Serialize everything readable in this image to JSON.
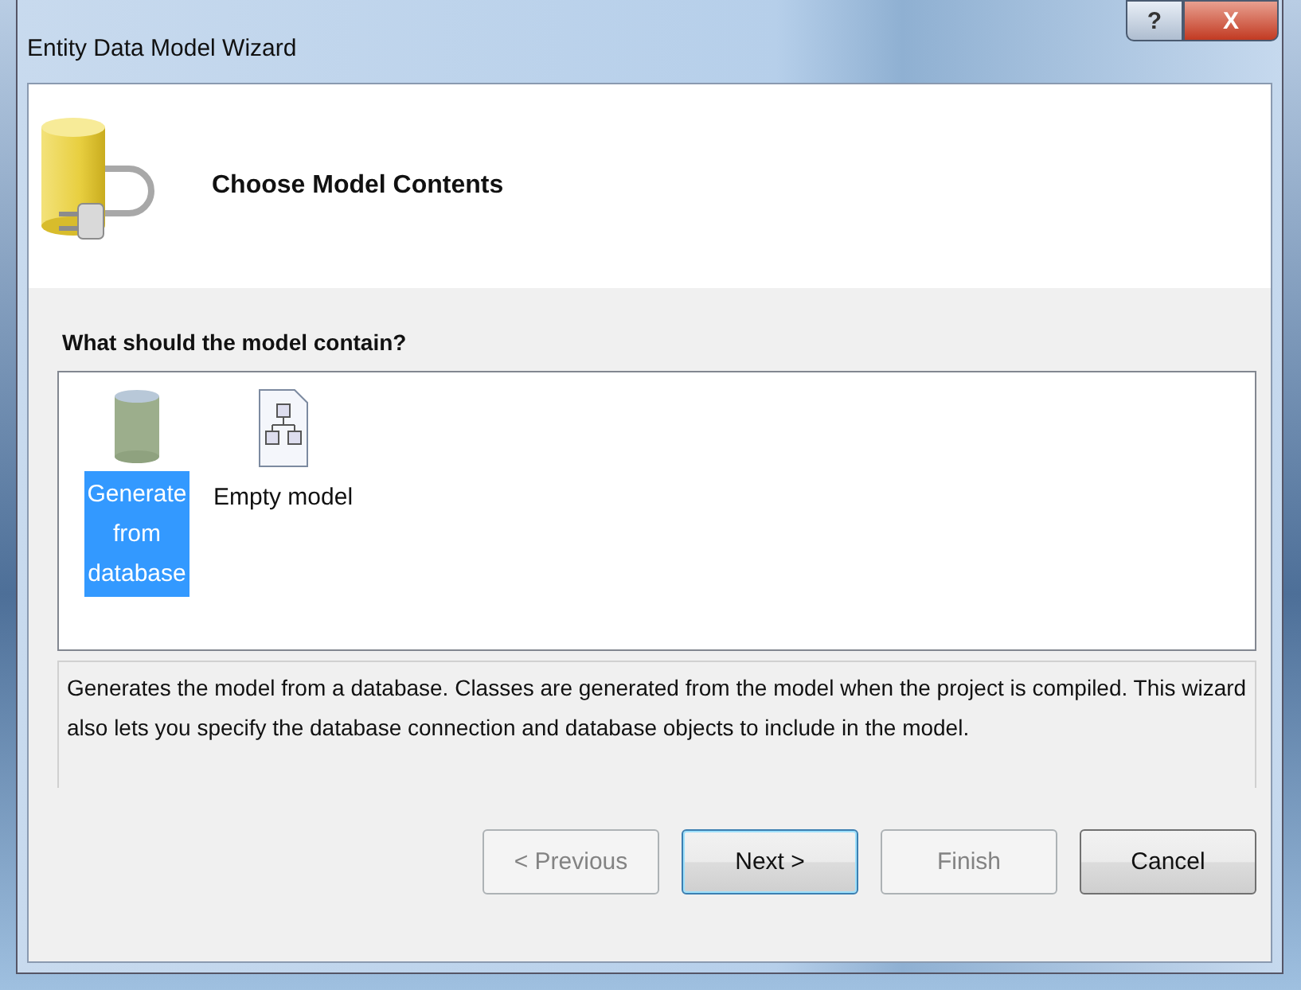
{
  "window": {
    "title": "Entity Data Model Wizard",
    "controls": [
      {
        "kind": "help",
        "label": "?"
      },
      {
        "kind": "close",
        "label": "X"
      }
    ]
  },
  "header": {
    "title": "Choose Model Contents"
  },
  "question": "What should the model contain?",
  "options": [
    {
      "kind": "database",
      "label": "Generate from database",
      "selected": true
    },
    {
      "kind": "document",
      "label": "Empty model",
      "selected": false
    }
  ],
  "description": "Generates the model from a database. Classes are generated from the model when the project is compiled. This wizard also lets you specify the database connection and database objects to include in the model.",
  "buttons": [
    {
      "label": "< Previous",
      "disabled": true,
      "default": false
    },
    {
      "label": "Next >",
      "disabled": false,
      "default": true
    },
    {
      "label": "Finish",
      "disabled": true,
      "default": false
    },
    {
      "label": "Cancel",
      "disabled": false,
      "default": false
    }
  ]
}
